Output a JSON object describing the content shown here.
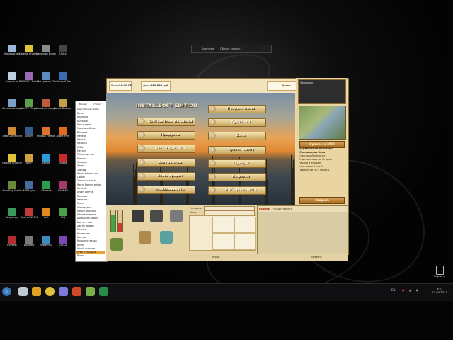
{
  "desktop": {
    "icons": [
      {
        "label": "Компьютер",
        "color": "#9bb8d8"
      },
      {
        "label": "Google Chrome",
        "color": "#e0c23a"
      },
      {
        "label": "Unknown Burning Drive",
        "color": "#8a8a8a"
      },
      {
        "label": "Unity",
        "color": "#444444"
      },
      {
        "label": "Корзина",
        "color": "#bcd0e0"
      },
      {
        "label": "DAEMON Tools Lite",
        "color": "#9a6ab0"
      },
      {
        "label": "Настройка ПК",
        "color": "#5a8ac0"
      },
      {
        "label": "Uninstall Tool",
        "color": "#3a6ab0"
      },
      {
        "label": "Автоматизация",
        "color": "#7aa0c8"
      },
      {
        "label": "MadTV Player",
        "color": "#5aa04a"
      },
      {
        "label": "Уровень продукта",
        "color": "#c05a3a"
      },
      {
        "label": "Game Booster",
        "color": "#c0a040"
      },
      {
        "label": "Total Commander",
        "color": "#d08a30"
      },
      {
        "label": "Steam",
        "color": "#3a5a8a"
      },
      {
        "label": "Mozilla Firefox",
        "color": "#e07030"
      },
      {
        "label": "Avast Free",
        "color": "#e06a20"
      },
      {
        "label": "Google Chrome",
        "color": "#e0c23a"
      },
      {
        "label": "AIMP",
        "color": "#d0a040"
      },
      {
        "label": "Skype",
        "color": "#2a9ad8"
      },
      {
        "label": "Opera",
        "color": "#c82a2a"
      },
      {
        "label": "AutoPlay Media",
        "color": "#6a8a3a"
      },
      {
        "label": "KMPlayer",
        "color": "#4a6aa0"
      },
      {
        "label": "uTorrent",
        "color": "#2aa04a"
      },
      {
        "label": "WinRAR",
        "color": "#a03a6a"
      },
      {
        "label": "Kaspersky",
        "color": "#3a9a5a"
      },
      {
        "label": "Alcohol 120%",
        "color": "#c03a3a"
      },
      {
        "label": "VLC",
        "color": "#e08a20"
      },
      {
        "label": "ICQ",
        "color": "#4aa04a"
      },
      {
        "label": "Everest",
        "color": "#b03030"
      },
      {
        "label": "Winamp",
        "color": "#7a7a7a"
      },
      {
        "label": "PowerISO",
        "color": "#3a8ac0"
      },
      {
        "label": "CPU-Z",
        "color": "#7a4ab0"
      }
    ]
  },
  "topbar": {
    "left": "Браузера",
    "right": "Облако (запуск)"
  },
  "left_window": {
    "tabs": [
      "Бизнес",
      "Статист"
    ],
    "title": "Карта бизнес Би-бу",
    "items": [
      "Бизон",
      "Алкоголь",
      "Бытовые",
      "Канцелярия",
      "Мягкая мебель",
      "Бытовая",
      "Мебель",
      "Фрукты",
      "Колбаса",
      "Зубы",
      "Металл",
      "Транспортная",
      "Мясные",
      "Сладкое",
      "Денег",
      "Звёзды",
      "Карта бизнес цуп",
      "Carsell",
      "Запчасти к авто",
      "Карта бизнес звёзд",
      "Alcoholo",
      "Шуфт цветов",
      "Золотые",
      "Напитки",
      "Ключ",
      "Шоколадки",
      "Новый дедушка",
      "Дешевое время",
      "Домашняя работа",
      "Цветы и мир",
      "Цветы дерева",
      "Лесные",
      "Кузнечное",
      "Цветки",
      "Кухонные ведра",
      "Кухни",
      "Юный пчелков",
      "Утка и игрушка",
      "Ящик"
    ],
    "selected_index": 37
  },
  "game": {
    "top": {
      "fields": [
        {
          "label": "Время:",
          "value": "16:00 СР"
        },
        {
          "label": "Деньги:",
          "value": "239 889 руб."
        }
      ],
      "right_label": "Проф",
      "page_label": "Доска"
    },
    "title": "INSTALLSOFT EDITION",
    "menu_left": [
      "Контрактные магазины",
      "Продукты",
      "Банк и кредиты",
      "Автодилеры",
      "Взять кредит",
      "Недвижимость"
    ],
    "menu_right": [
      "Продать мыло",
      "Аукционы",
      "Банк",
      "Купить газету",
      "Турниры",
      "Кофейни",
      "Рыбацкие места"
    ],
    "right_panel": {
      "box_label": "Заголовок",
      "desc": [
        "Деревенские просторы.",
        "Мыловарная база",
        "Стартовый капитал",
        "Отдельная цель: Второй",
        "Работа в Москве",
        "Участники 4 (по 4)",
        "Перевести на 4 мыла 1"
      ],
      "buttons": [
        "Купить за 2000",
        "Закрыть"
      ]
    },
    "bottom": {
      "progress": [
        {
          "label": "Улучшить",
          "fraction": 0.0
        },
        {
          "label": "Лимит",
          "fraction": 0.0
        }
      ],
      "gauges": [
        {
          "name": "Сила",
          "fraction": 0.8,
          "color": "#3aa84a"
        },
        {
          "name": "Еда",
          "fraction": 0.4,
          "color": "#c04030"
        }
      ],
      "news_title": "Новые новости",
      "news_tab": "Рыбная",
      "status_left": "Игрок",
      "status_right": "Уровень"
    }
  },
  "taskbar": {
    "time": "9:51",
    "date": "17.05.2013",
    "lang": "EN",
    "recycle_label": "Корзина"
  }
}
